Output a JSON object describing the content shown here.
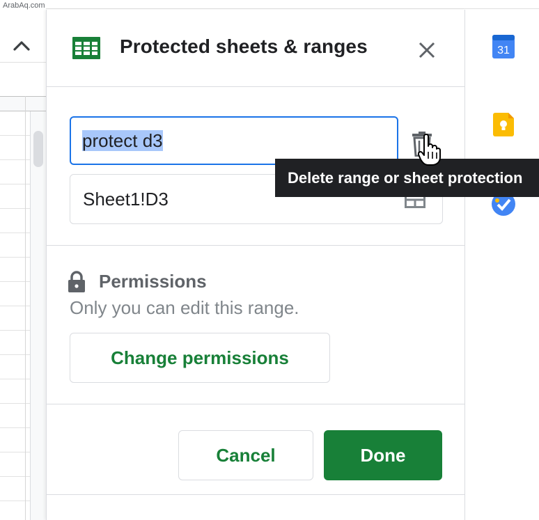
{
  "watermark": "ArabAq.com",
  "panel": {
    "title": "Protected sheets & ranges",
    "range": {
      "description_value": "protect d3",
      "range_value": "Sheet1!D3"
    },
    "permissions": {
      "title": "Permissions",
      "description": "Only you can edit this range.",
      "change_button": "Change permissions"
    },
    "footer": {
      "cancel_label": "Cancel",
      "done_label": "Done"
    }
  },
  "tooltip": {
    "text": "Delete range or sheet protection"
  },
  "side_panel": {
    "calendar_day": "31",
    "icons": [
      "calendar-icon",
      "keep-icon",
      "tasks-icon"
    ]
  },
  "icons": {
    "collapse": "chevron-up-icon",
    "app": "sheets-icon",
    "close": "close-icon",
    "delete": "trash-icon",
    "range_picker": "grid-select-icon",
    "permissions": "lock-icon",
    "pointer": "hand-cursor-icon"
  },
  "colors": {
    "accent_blue": "#1a73e8",
    "sheets_green": "#188038",
    "tooltip_bg": "#202124",
    "selection": "#a8c7fa",
    "calendar_blue": "#4285f4",
    "keep_yellow": "#fbbc04"
  }
}
